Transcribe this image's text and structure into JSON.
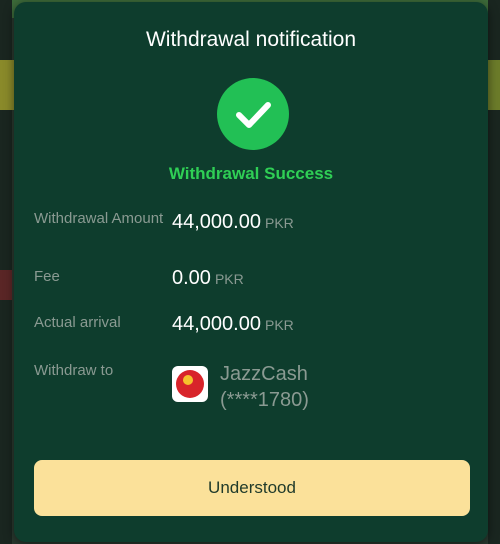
{
  "modal": {
    "title": "Withdrawal notification",
    "status": "Withdrawal Success",
    "rows": {
      "amount": {
        "label": "Withdrawal Amount",
        "value": "44,000.00",
        "unit": "PKR"
      },
      "fee": {
        "label": "Fee",
        "value": "0.00",
        "unit": "PKR"
      },
      "arrival": {
        "label": "Actual arrival",
        "value": "44,000.00",
        "unit": "PKR"
      },
      "withdraw_to": {
        "label": "Withdraw to",
        "method": "JazzCash",
        "account": "(****1780)",
        "icon": "jazzcash-logo-icon"
      }
    },
    "button_label": "Understood",
    "status_icon": "checkmark-icon"
  },
  "colors": {
    "modal_bg": "#0e3d2d",
    "success_green": "#22c055",
    "status_text": "#2fcf55",
    "button_bg": "#fbe19a"
  }
}
